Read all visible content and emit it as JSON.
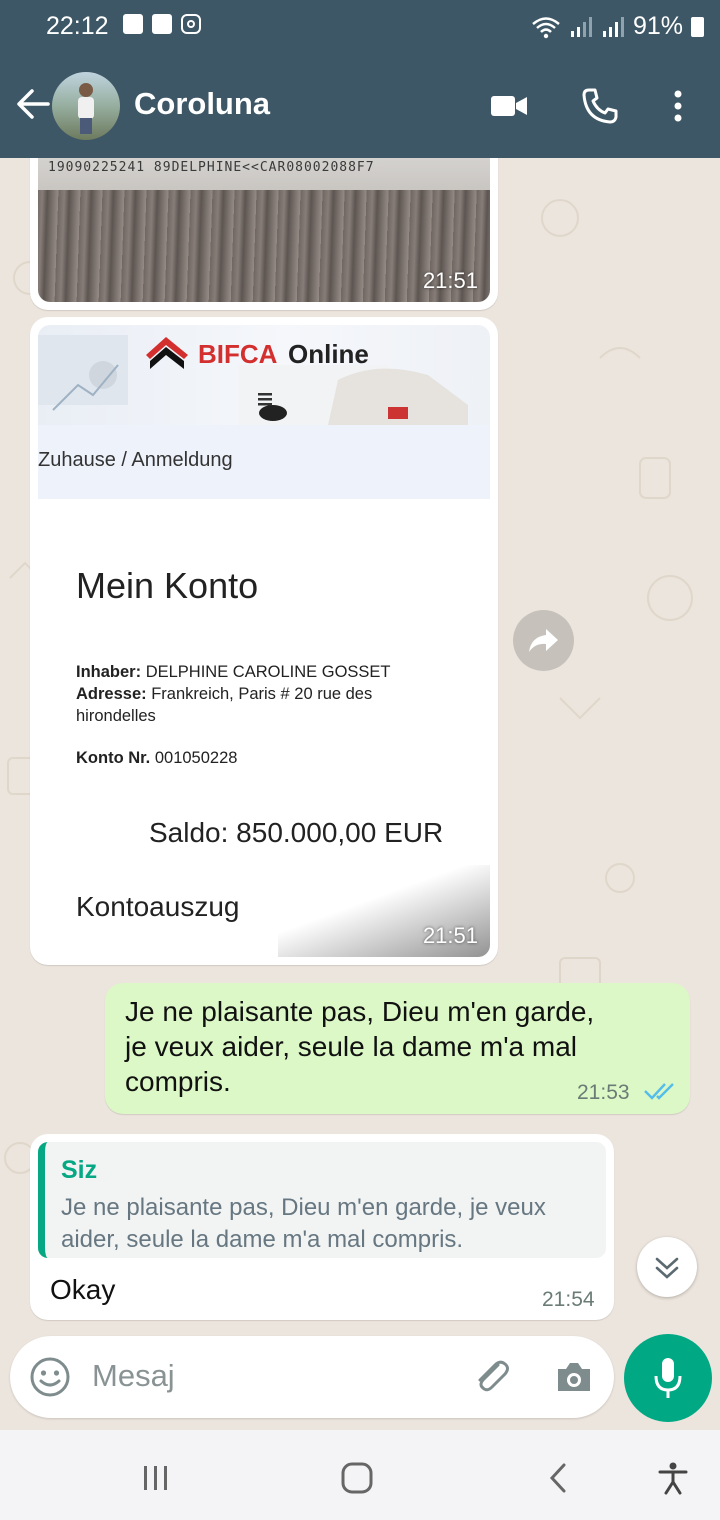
{
  "status": {
    "time": "22:12",
    "battery": "91%"
  },
  "header": {
    "contact_name": "Coroluna"
  },
  "messages": {
    "image1": {
      "mrz_text": "19090225241 89DELPHINE<<CAR08002088F7",
      "time": "21:51"
    },
    "image2": {
      "brand": "BIFCA",
      "brand_suffix": "Online",
      "breadcrumb": "Zuhause / Anmeldung",
      "title": "Mein Konto",
      "inhaber_label": "Inhaber:",
      "inhaber_value": "DELPHINE CAROLINE GOSSET",
      "adresse_label": "Adresse:",
      "adresse_value": "Frankreich, Paris # 20 rue des",
      "adresse_value2": "hirondelles",
      "konto_label": "Konto Nr.",
      "konto_value": "001050228",
      "saldo": "Saldo: 850.000,00 EUR",
      "kontoauszug": "Kontoauszug",
      "time": "21:51"
    },
    "outgoing": {
      "line1": "Je ne plaisante pas, Dieu m'en garde,",
      "line2": "je veux aider, seule la dame m'a mal",
      "line3": "compris.",
      "time": "21:53"
    },
    "reply": {
      "quote_author": "Siz",
      "quote_line1": "Je ne plaisante pas, Dieu m'en garde, je veux",
      "quote_line2": "aider, seule la dame m'a mal compris.",
      "text": "Okay",
      "time": "21:54"
    }
  },
  "input": {
    "placeholder": "Mesaj"
  },
  "colors": {
    "header": "#3d5766",
    "accent": "#00a884",
    "outgoing_bubble": "#dcf8c6",
    "read_ticks": "#53bdeb"
  }
}
